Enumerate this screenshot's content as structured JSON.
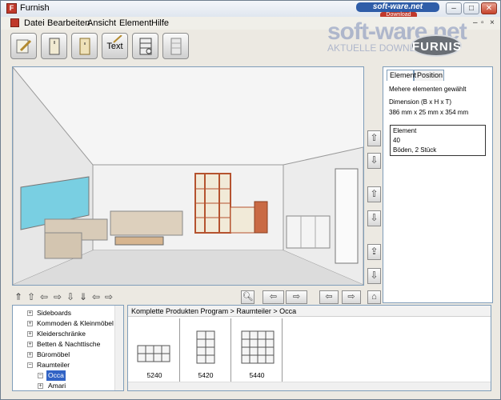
{
  "window": {
    "title": "Furnish"
  },
  "watermark": {
    "site": "soft-ware.net",
    "download": "Download",
    "big": "soft-ware.net",
    "sub": "AKTUELLE DOWNLOADS"
  },
  "logo": {
    "text": "FURNIS"
  },
  "menu": [
    "Datei",
    "Bearbeiten",
    "Ansicht",
    "Element",
    "Hilfe"
  ],
  "toolbar": {
    "text_tool_label": "Text"
  },
  "properties": {
    "tabs": [
      "Element",
      "Position"
    ],
    "selection_text": "Mehere elementen gewählt",
    "dimension_label": "Dimension (B x H x T)",
    "dimension_value": "386 mm x 25 mm x 354 mm",
    "element_box": {
      "title": "Element",
      "id": "40",
      "desc": "Böden, 2 Stück"
    }
  },
  "tree": {
    "items": [
      {
        "label": "Sideboards",
        "expander": "+"
      },
      {
        "label": "Kommoden & Kleinmöbel",
        "expander": "+"
      },
      {
        "label": "Kleiderschränke",
        "expander": "+"
      },
      {
        "label": "Betten & Nachttische",
        "expander": "+"
      },
      {
        "label": "Büromöbel",
        "expander": "+"
      },
      {
        "label": "Raumteiler",
        "expander": "−"
      },
      {
        "label": "Occa",
        "expander": "−",
        "selected": true
      },
      {
        "label": "Amari",
        "expander": "+"
      }
    ]
  },
  "breadcrumb": "Komplette Produkten Program > Raumteiler > Occa",
  "products": [
    {
      "code": "5240"
    },
    {
      "code": "5420"
    },
    {
      "code": "5440"
    }
  ],
  "colors": {
    "accent": "#3163c5",
    "shelf": "#b5532f",
    "frame": "#7f9db9"
  }
}
